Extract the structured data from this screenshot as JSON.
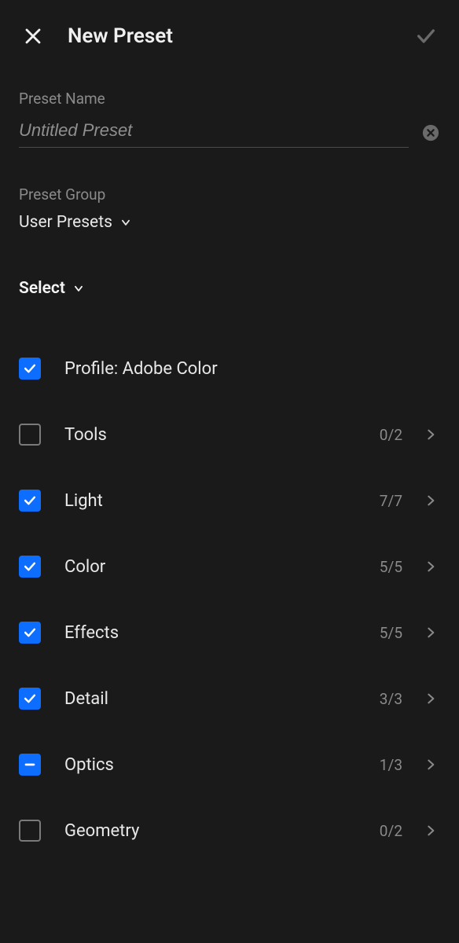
{
  "header": {
    "title": "New Preset"
  },
  "presetName": {
    "label": "Preset Name",
    "placeholder": "Untitled Preset",
    "value": ""
  },
  "presetGroup": {
    "label": "Preset Group",
    "value": "User Presets"
  },
  "select": {
    "label": "Select"
  },
  "options": [
    {
      "label": "Profile: Adobe Color",
      "state": "checked",
      "count": "",
      "expandable": false
    },
    {
      "label": "Tools",
      "state": "unchecked",
      "count": "0/2",
      "expandable": true
    },
    {
      "label": "Light",
      "state": "checked",
      "count": "7/7",
      "expandable": true
    },
    {
      "label": "Color",
      "state": "checked",
      "count": "5/5",
      "expandable": true
    },
    {
      "label": "Effects",
      "state": "checked",
      "count": "5/5",
      "expandable": true
    },
    {
      "label": "Detail",
      "state": "checked",
      "count": "3/3",
      "expandable": true
    },
    {
      "label": "Optics",
      "state": "partial",
      "count": "1/3",
      "expandable": true
    },
    {
      "label": "Geometry",
      "state": "unchecked",
      "count": "0/2",
      "expandable": true
    }
  ]
}
